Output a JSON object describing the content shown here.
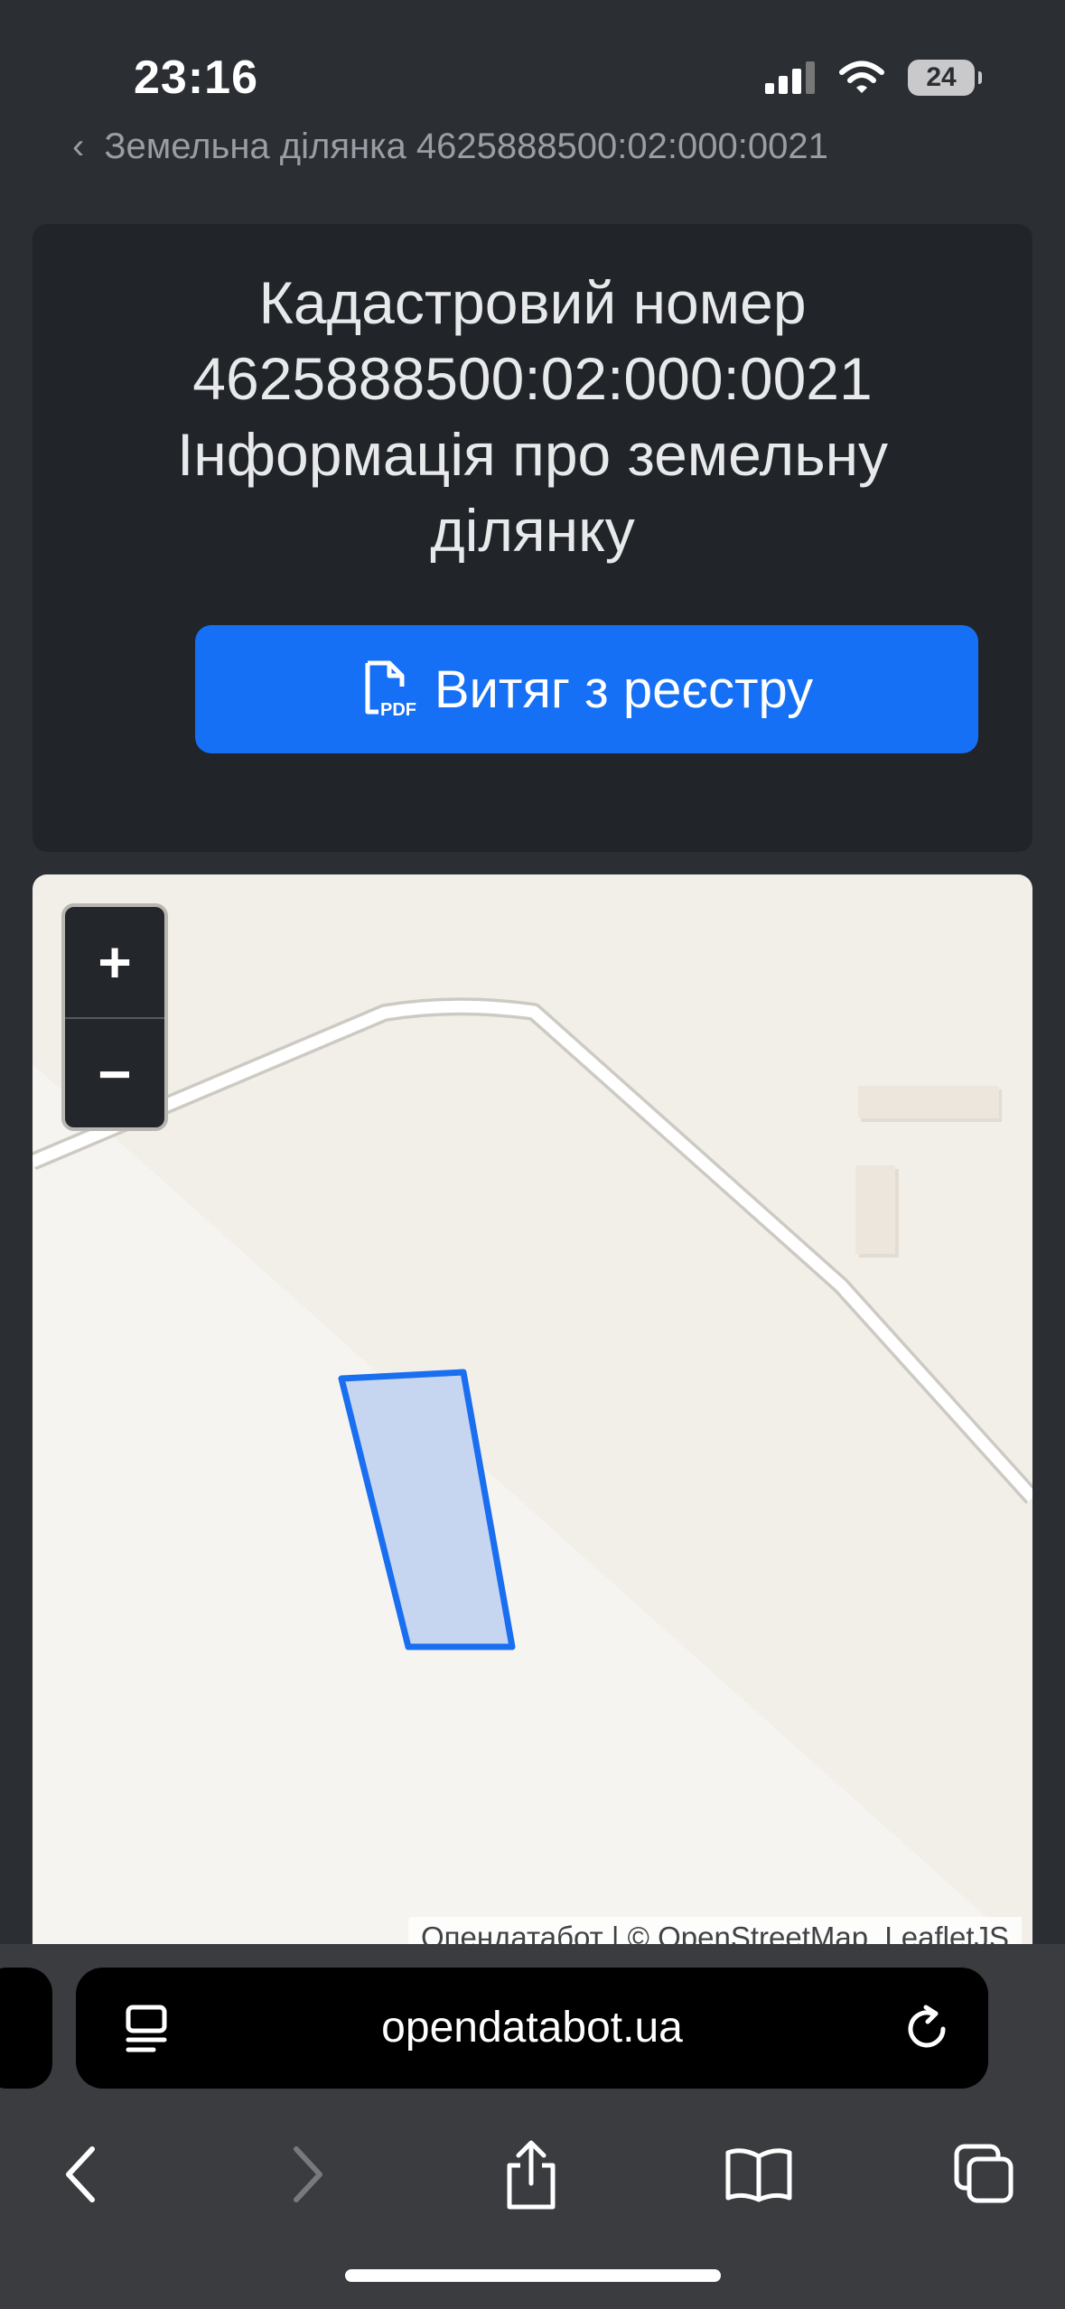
{
  "status_bar": {
    "time": "23:16",
    "battery": "24"
  },
  "breadcrumb": {
    "text": "Земельна ділянка 4625888500:02:000:0021"
  },
  "info_card": {
    "title_line1": "Кадастровий номер",
    "title_line2": "4625888500:02:000:0021",
    "title_line3": "Інформація про земельну",
    "title_line4": "ділянку",
    "pdf_button_label": "Витяг з реєстру",
    "pdf_icon_text": "PDF"
  },
  "map": {
    "zoom_in": "+",
    "zoom_out": "−",
    "attribution": "Опендатабот | © OpenStreetMap, LeafletJS",
    "parcel_fill": "#c6d6f1",
    "parcel_stroke": "#1a6ef0"
  },
  "browser": {
    "url": "opendatabot.ua"
  },
  "colors": {
    "accent": "#1570f5",
    "page_bg": "#2b2e33",
    "card_bg": "#212429",
    "map_bg": "#f2efe9"
  }
}
